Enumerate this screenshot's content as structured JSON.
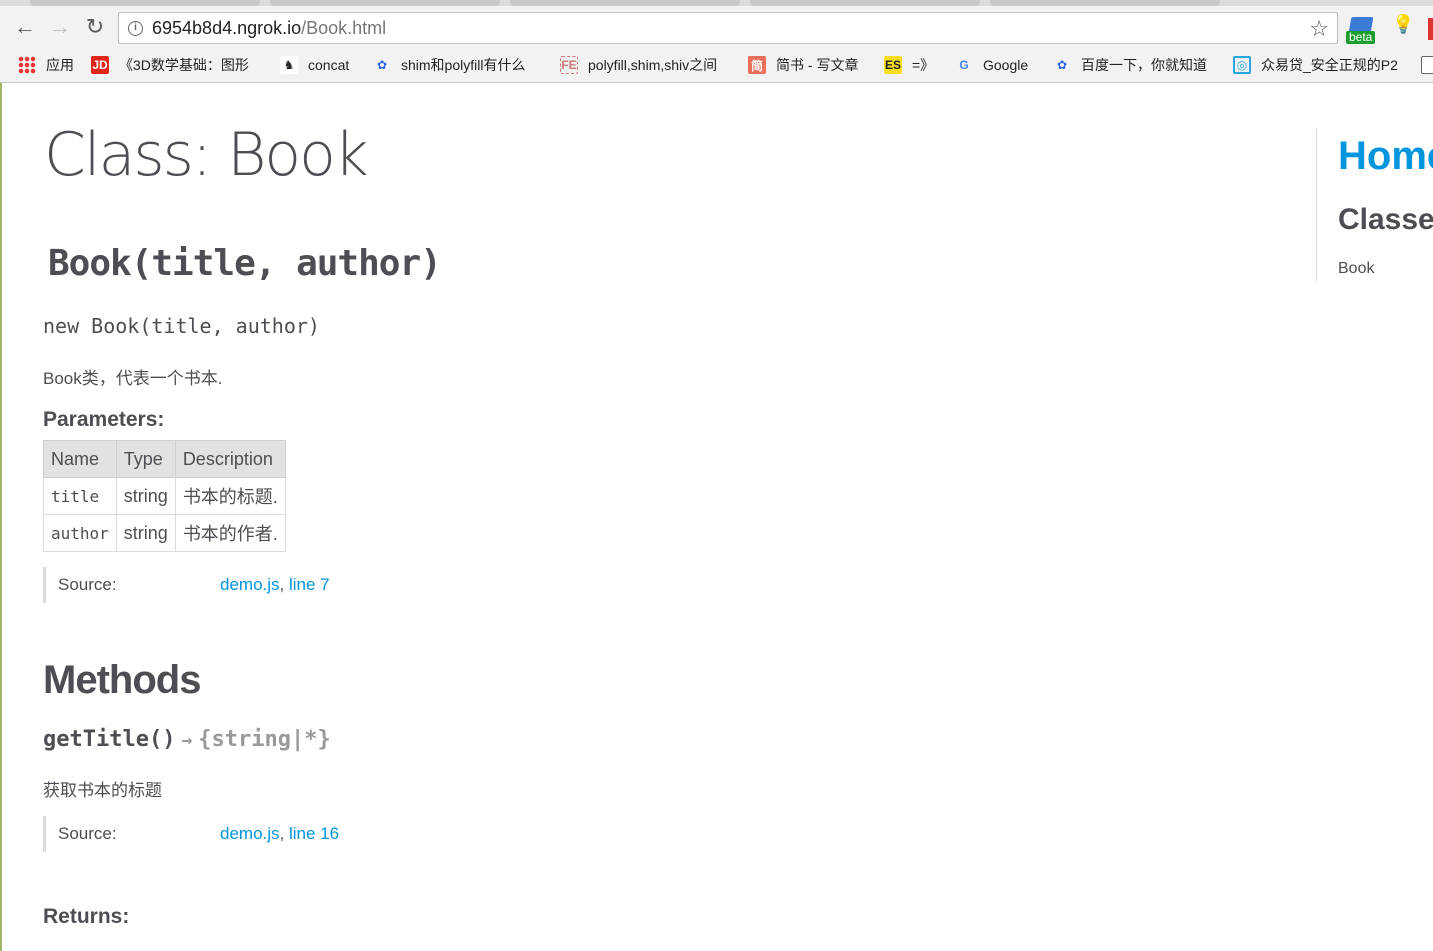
{
  "browser": {
    "url_host": "6954b8d4.ngrok.io",
    "url_path": "/Book.html",
    "extension_badge": "beta",
    "bookmarks": [
      {
        "icon": "apps-icon",
        "label": "应用"
      },
      {
        "icon": "jd-icon",
        "label": "《3D数学基础：图形"
      },
      {
        "icon": "cat-icon",
        "label": "concat"
      },
      {
        "icon": "baidu-paw-icon",
        "label": "shim和polyfill有什么"
      },
      {
        "icon": "fe-icon",
        "label": "polyfill,shim,shiv之间"
      },
      {
        "icon": "jianshu-icon",
        "label": "简书 - 写文章"
      },
      {
        "icon": "es-icon",
        "label": "=》"
      },
      {
        "icon": "google-icon",
        "label": "Google"
      },
      {
        "icon": "baidu-paw-icon",
        "label": "百度一下，你就知道"
      },
      {
        "icon": "zhongyidai-icon",
        "label": "众易贷_安全正规的P2"
      }
    ],
    "icon_glyphs": {
      "jd": "JD",
      "jianshu": "简",
      "es": "ES",
      "google": "G",
      "fe": "FE"
    }
  },
  "page": {
    "class_title": "Class: Book",
    "constructor": {
      "heading": "Book(title, author)",
      "signature": "new Book(title, author)",
      "description": "Book类，代表一个书本.",
      "parameters_label": "Parameters:",
      "table": {
        "headers": [
          "Name",
          "Type",
          "Description"
        ],
        "rows": [
          [
            "title",
            "string",
            "书本的标题."
          ],
          [
            "author",
            "string",
            "书本的作者."
          ]
        ]
      },
      "source": {
        "label": "Source:",
        "file": "demo.js",
        "sep": ",",
        "line": "line 7"
      }
    },
    "methods": {
      "title": "Methods",
      "items": [
        {
          "name": "getTitle()",
          "arrow": "→",
          "returns": "{string|*}",
          "description": "获取书本的标题",
          "source": {
            "label": "Source:",
            "file": "demo.js",
            "sep": ",",
            "line": "line 16"
          },
          "returns_label": "Returns:"
        }
      ]
    }
  },
  "nav": {
    "home": "Home",
    "classes_heading": "Classes",
    "classes": [
      "Book"
    ]
  }
}
